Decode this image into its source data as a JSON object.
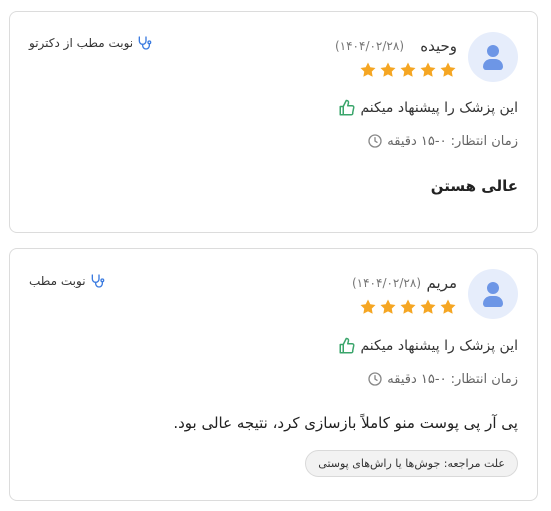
{
  "reviews": [
    {
      "name": "وحیده",
      "date": "(۱۴۰۴/۰۲/۲۸)",
      "rating": 5,
      "reserve_label": "نوبت مطب از دکترتو",
      "recommend_text": "این پزشک را پیشنهاد میکنم",
      "wait_text": "زمان انتظار: ۰-۱۵ دقیقه",
      "comment": "عالی هستن"
    },
    {
      "name": "مریم",
      "date": "(۱۴۰۴/۰۲/۲۸)",
      "rating": 5,
      "reserve_label": "نوبت مطب",
      "recommend_text": "این پزشک را پیشنهاد میکنم",
      "wait_text": "زمان انتظار: ۰-۱۵ دقیقه",
      "comment": "پی آر پی پوست منو کاملاً بازسازی کرد، نتیجه عالی بود.",
      "reason_chip": "علت مراجعه: جوش‌ها یا راش‌های پوستی"
    }
  ],
  "colors": {
    "star": "#f5a623",
    "thumb": "#3aa56b",
    "avatar_bg": "#e6edfb",
    "avatar_fg": "#6d96e6",
    "stethoscope": "#3b7be0"
  },
  "icons": {
    "avatar": "user-avatar-icon",
    "star": "star-icon",
    "thumb": "thumbs-up-icon",
    "clock": "clock-icon",
    "stethoscope": "stethoscope-icon"
  }
}
